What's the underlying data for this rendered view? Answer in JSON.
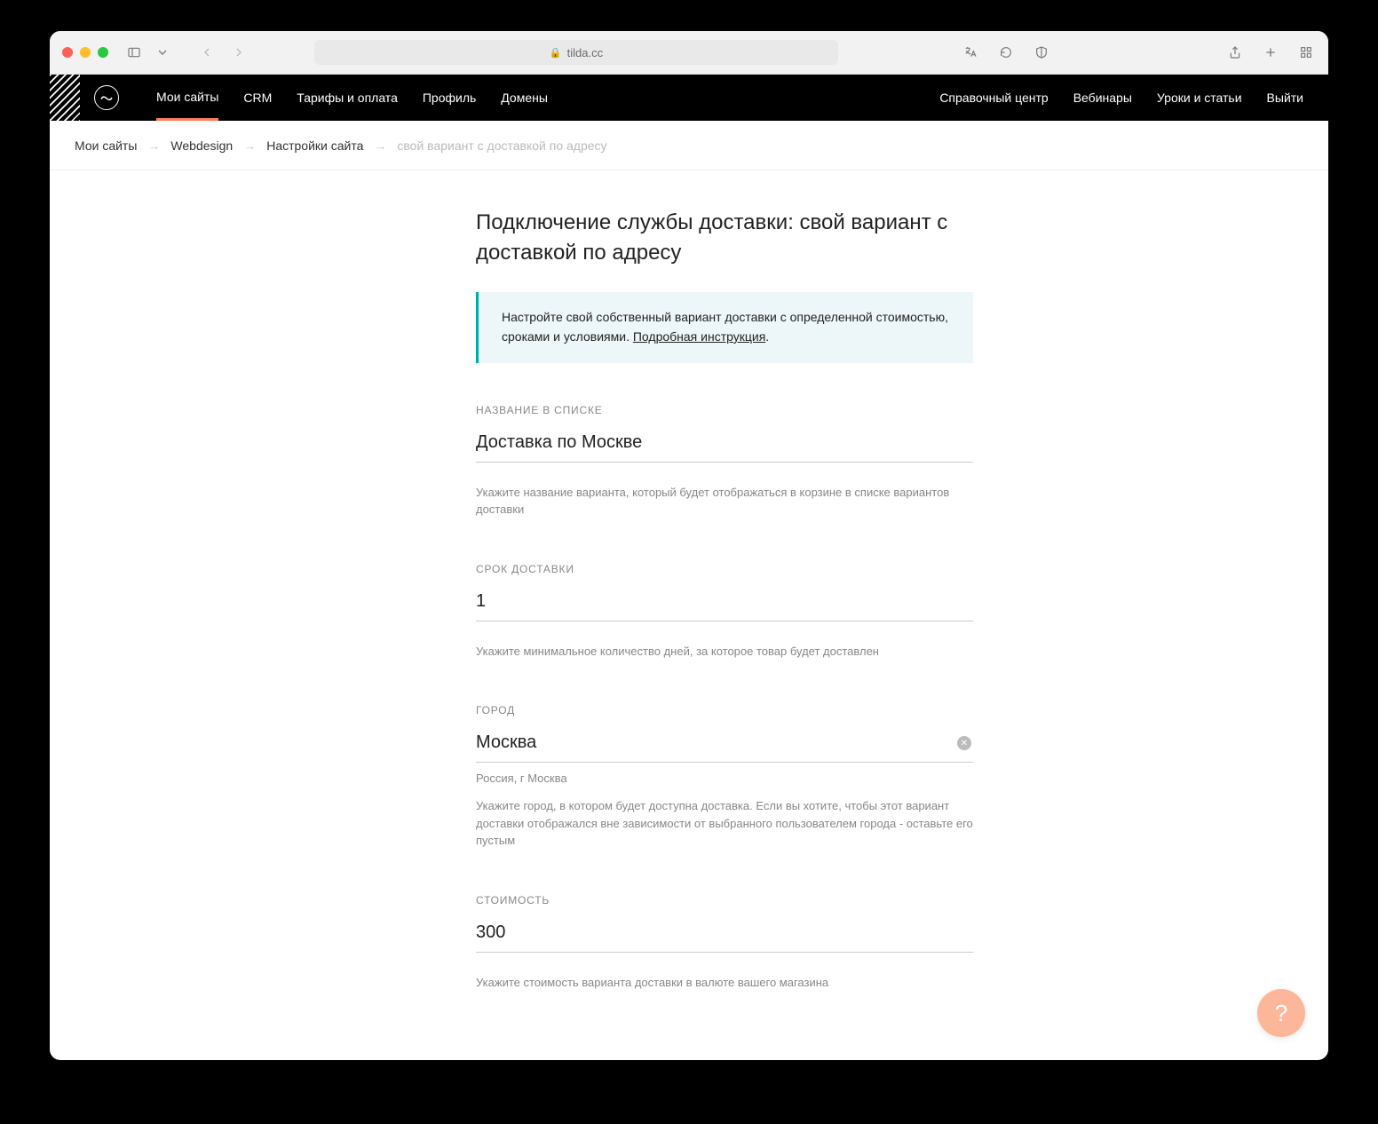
{
  "browser": {
    "url": "tilda.cc"
  },
  "nav": {
    "left": [
      "Мои сайты",
      "CRM",
      "Тарифы и оплата",
      "Профиль",
      "Домены"
    ],
    "right": [
      "Справочный центр",
      "Вебинары",
      "Уроки и статьи",
      "Выйти"
    ],
    "active_index": 0
  },
  "breadcrumbs": [
    "Мои сайты",
    "Webdesign",
    "Настройки сайта",
    "свой вариант с доставкой по адресу"
  ],
  "page": {
    "title": "Подключение службы доставки: свой вариант с доставкой по адресу",
    "callout_text": "Настройте свой собственный вариант доставки с определенной стоимостью, сроками и условиями. ",
    "callout_link": "Подробная инструкция",
    "callout_after": "."
  },
  "form": {
    "name": {
      "label": "НАЗВАНИЕ В СПИСКЕ",
      "value": "Доставка по Москве",
      "hint": "Укажите название варианта, который будет отображаться в корзине в списке вариантов доставки"
    },
    "duration": {
      "label": "СРОК ДОСТАВКИ",
      "value": "1",
      "hint": "Укажите минимальное количество дней, за которое товар будет доставлен"
    },
    "city": {
      "label": "ГОРОД",
      "value": "Москва",
      "resolved": "Россия, г Москва",
      "hint": "Укажите город, в котором будет доступна доставка. Если вы хотите, чтобы этот вариант доставки отображался вне зависимости от выбранного пользователем города - оставьте его пустым"
    },
    "price": {
      "label": "СТОИМОСТЬ",
      "value": "300",
      "hint": "Укажите стоимость варианта доставки в валюте вашего магазина"
    }
  },
  "help_fab": "?"
}
